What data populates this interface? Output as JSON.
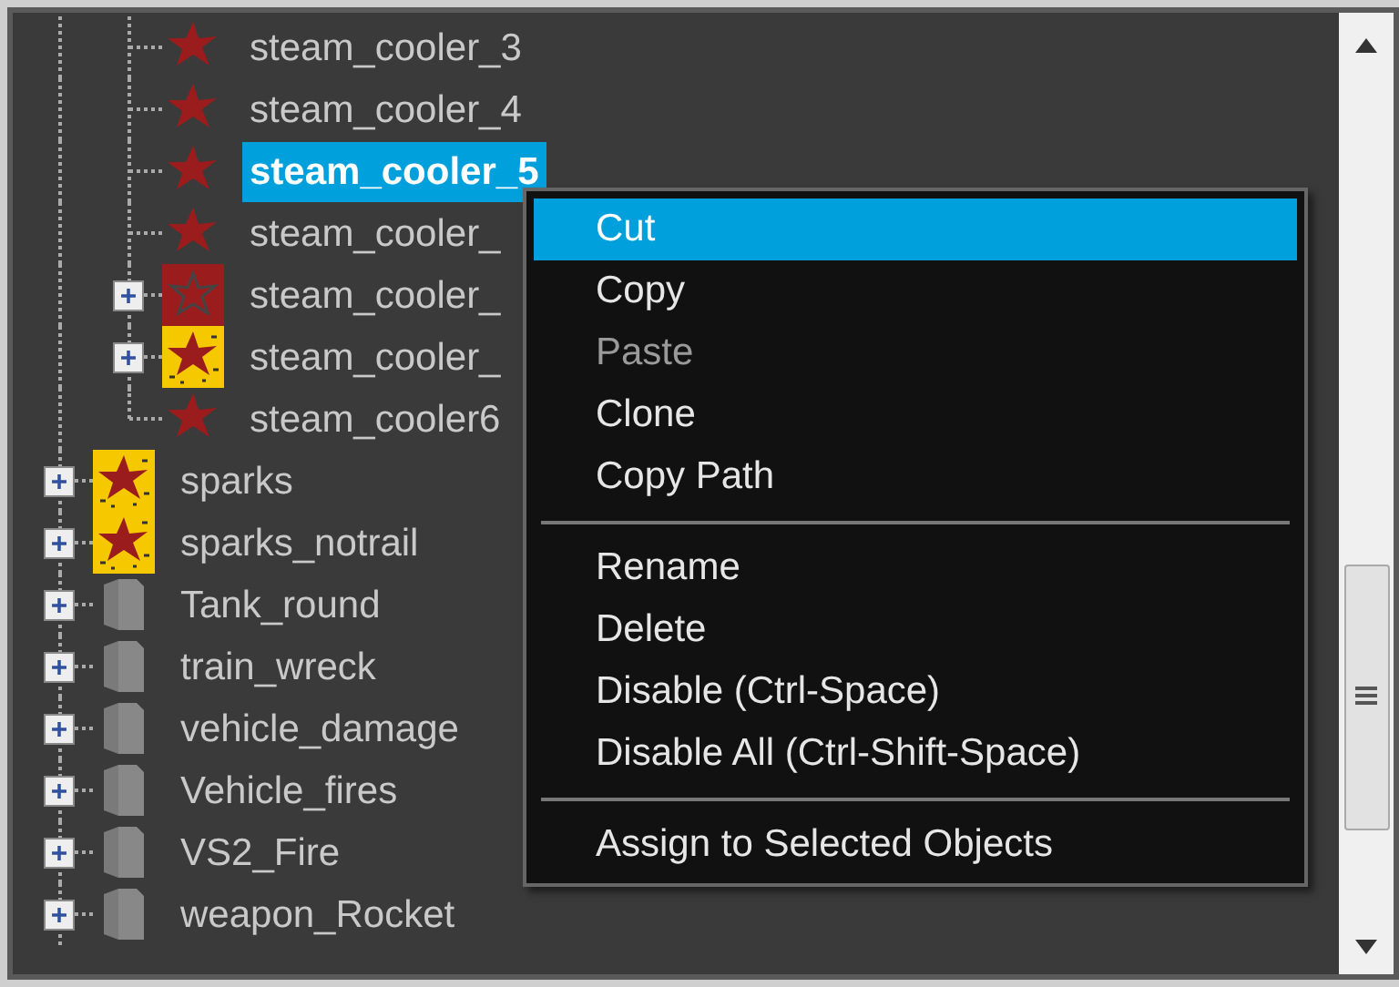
{
  "tree": {
    "items": [
      {
        "children": [
          {
            "label": "steam_cooler_3",
            "kind": "star",
            "expandable": false,
            "selected": false
          },
          {
            "label": "steam_cooler_4",
            "kind": "star",
            "expandable": false,
            "selected": false
          },
          {
            "label": "steam_cooler_5",
            "kind": "star",
            "expandable": false,
            "selected": true
          },
          {
            "label": "steam_cooler_",
            "kind": "star",
            "expandable": false,
            "selected": false
          },
          {
            "label": "steam_cooler_",
            "kind": "red-tile",
            "expandable": true,
            "selected": false
          },
          {
            "label": "steam_cooler_",
            "kind": "yellow-tile",
            "expandable": true,
            "selected": false
          },
          {
            "label": "steam_cooler6",
            "kind": "star",
            "expandable": false,
            "selected": false
          }
        ]
      },
      {
        "label": "sparks",
        "kind": "yellow-tile",
        "expandable": true,
        "selected": false
      },
      {
        "label": "sparks_notrail",
        "kind": "yellow-tile",
        "expandable": true,
        "selected": false
      },
      {
        "label": "Tank_round",
        "kind": "folder",
        "expandable": true,
        "selected": false
      },
      {
        "label": "train_wreck",
        "kind": "folder",
        "expandable": true,
        "selected": false
      },
      {
        "label": "vehicle_damage",
        "kind": "folder",
        "expandable": true,
        "selected": false
      },
      {
        "label": "Vehicle_fires",
        "kind": "folder",
        "expandable": true,
        "selected": false
      },
      {
        "label": "VS2_Fire",
        "kind": "folder",
        "expandable": true,
        "selected": false
      },
      {
        "label": "weapon_Rocket",
        "kind": "folder",
        "expandable": true,
        "selected": false
      }
    ]
  },
  "context_menu": {
    "items": [
      {
        "kind": "item",
        "label": "Cut",
        "selected": true,
        "disabled": false
      },
      {
        "kind": "item",
        "label": "Copy",
        "selected": false,
        "disabled": false
      },
      {
        "kind": "item",
        "label": "Paste",
        "selected": false,
        "disabled": true
      },
      {
        "kind": "item",
        "label": "Clone",
        "selected": false,
        "disabled": false
      },
      {
        "kind": "item",
        "label": "Copy Path",
        "selected": false,
        "disabled": false
      },
      {
        "kind": "separator"
      },
      {
        "kind": "item",
        "label": "Rename",
        "selected": false,
        "disabled": false
      },
      {
        "kind": "item",
        "label": "Delete",
        "selected": false,
        "disabled": false
      },
      {
        "kind": "item",
        "label": "Disable (Ctrl-Space)",
        "selected": false,
        "disabled": false
      },
      {
        "kind": "item",
        "label": "Disable All (Ctrl-Shift-Space)",
        "selected": false,
        "disabled": false
      },
      {
        "kind": "separator"
      },
      {
        "kind": "item",
        "label": "Assign to Selected Objects",
        "selected": false,
        "disabled": false
      }
    ]
  }
}
